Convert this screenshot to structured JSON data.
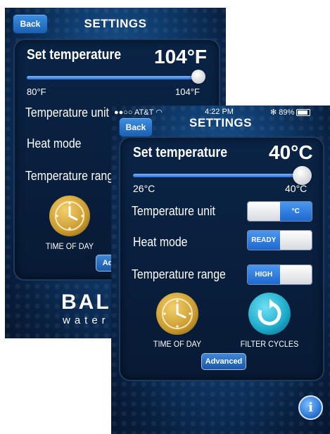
{
  "back_screen": {
    "back_label": "Back",
    "title": "SETTINGS",
    "set_temperature_label": "Set temperature",
    "set_temperature_value": "104°F",
    "slider_min": "80°F",
    "slider_max": "104°F",
    "slider_level": 1.0,
    "temperature_unit_label": "Temperature unit",
    "heat_mode_label": "Heat mode",
    "temperature_range_label": "Temperature range",
    "time_of_day_label": "TIME OF DAY",
    "advanced_label": "Advanced",
    "brand_name": "BALBOA",
    "brand_tagline": "water group"
  },
  "front_screen": {
    "status_bar": {
      "carrier": "●●○○ AT&T",
      "time": "4:22 PM",
      "battery": "89%"
    },
    "back_label": "Back",
    "title": "SETTINGS",
    "set_temperature_label": "Set temperature",
    "set_temperature_value": "40°C",
    "slider_min": "26°C",
    "slider_max": "40°C",
    "slider_level": 1.0,
    "temperature_unit": {
      "label": "Temperature unit",
      "selected": "°C"
    },
    "heat_mode": {
      "label": "Heat mode",
      "selected": "READY"
    },
    "temperature_range": {
      "label": "Temperature range",
      "selected": "HIGH"
    },
    "time_of_day_label": "TIME OF DAY",
    "filter_cycles_label": "FILTER CYCLES",
    "advanced_label": "Advanced"
  },
  "colors": {
    "accent_blue": "#1e68cf",
    "background_dark": "#081f3f",
    "clock_gold": "#c99a2e",
    "filter_teal": "#1aa9c8"
  }
}
